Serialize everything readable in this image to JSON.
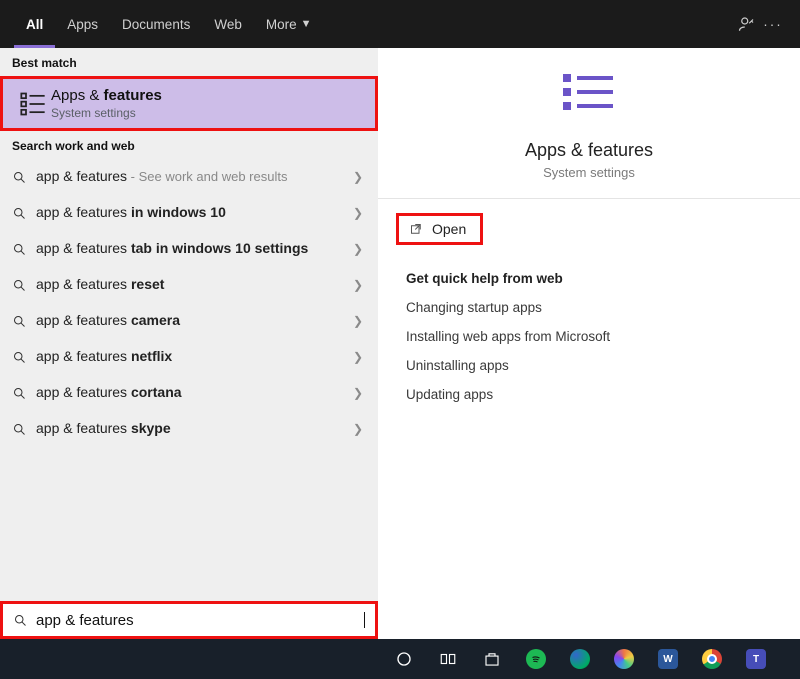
{
  "tabs": {
    "all": "All",
    "apps": "Apps",
    "documents": "Documents",
    "web": "Web",
    "more": "More"
  },
  "left": {
    "best_match_label": "Best match",
    "best_match": {
      "prefix": "Apps & ",
      "bold": "features",
      "subtitle": "System settings"
    },
    "search_section_label": "Search work and web",
    "results": [
      {
        "prefix": "app & features",
        "bold": "",
        "suffix_light": " - See work and web results"
      },
      {
        "prefix": "app & features ",
        "bold": "in windows 10",
        "suffix_light": ""
      },
      {
        "prefix": "app & features ",
        "bold": "tab in windows 10 settings",
        "suffix_light": ""
      },
      {
        "prefix": "app & features ",
        "bold": "reset",
        "suffix_light": ""
      },
      {
        "prefix": "app & features ",
        "bold": "camera",
        "suffix_light": ""
      },
      {
        "prefix": "app & features ",
        "bold": "netflix",
        "suffix_light": ""
      },
      {
        "prefix": "app & features ",
        "bold": "cortana",
        "suffix_light": ""
      },
      {
        "prefix": "app & features ",
        "bold": "skype",
        "suffix_light": ""
      }
    ],
    "search_value": "app & features"
  },
  "right": {
    "hero_title": "Apps & features",
    "hero_sub": "System settings",
    "open_label": "Open",
    "help_title": "Get quick help from web",
    "help_links": [
      "Changing startup apps",
      "Installing web apps from Microsoft",
      "Uninstalling apps",
      "Updating apps"
    ]
  },
  "taskbar": {
    "items": [
      "cortana",
      "task-view",
      "store",
      "spotify",
      "edge",
      "paint",
      "word",
      "chrome",
      "teams"
    ]
  }
}
